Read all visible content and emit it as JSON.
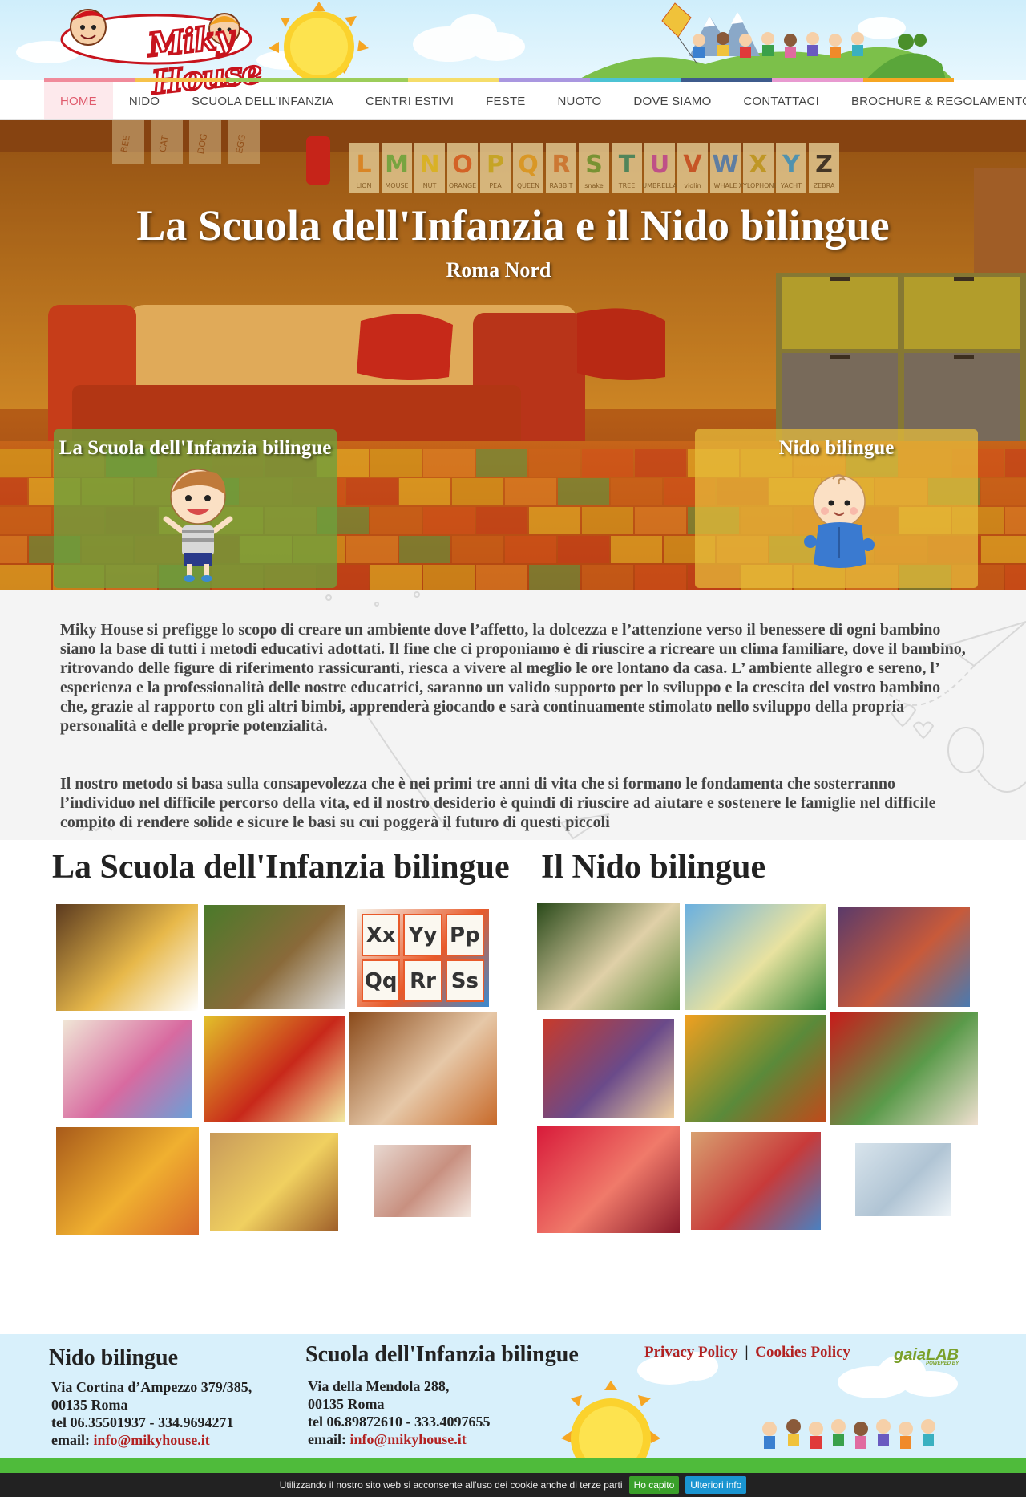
{
  "header": {
    "logo_text": "Miky House",
    "nav": [
      {
        "label": "HOME",
        "active": true
      },
      {
        "label": "NIDO",
        "active": false
      },
      {
        "label": "SCUOLA DELL'INFANZIA",
        "active": false
      },
      {
        "label": "CENTRI ESTIVI",
        "active": false
      },
      {
        "label": "FESTE",
        "active": false
      },
      {
        "label": "NUOTO",
        "active": false
      },
      {
        "label": "DOVE SIAMO",
        "active": false
      },
      {
        "label": "CONTATTACI",
        "active": false
      },
      {
        "label": "BROCHURE & REGOLAMENTO",
        "active": false
      }
    ],
    "strip_colors": [
      "#f08a9a",
      "#f6c24a",
      "#9ccd5a",
      "#9ccd5a",
      "#f5dd6a",
      "#a997e0",
      "#4cc3d4",
      "#3d5b8c",
      "#e89ad0",
      "#f6a623"
    ]
  },
  "hero": {
    "title": "La Scuola dell'Infanzia e il Nido bilingue",
    "subtitle": "Roma Nord",
    "card_infanzia": "La Scuola dell'Infanzia bilingue",
    "card_nido": "Nido bilingue",
    "alphabet_letters": [
      "L",
      "M",
      "N",
      "O",
      "P",
      "Q",
      "R",
      "S",
      "T",
      "U",
      "V",
      "W",
      "X",
      "Y",
      "Z"
    ],
    "alphabet_words": [
      "LION",
      "MOUSE",
      "NUT",
      "ORANGE",
      "PEA",
      "QUEEN",
      "RABBIT",
      "snake",
      "TREE",
      "UMBRELLA",
      "violin",
      "WHALE",
      "XYLOPHONE",
      "YACHT",
      "ZEBRA"
    ],
    "wall_words": [
      "BEE",
      "CAT",
      "DOG",
      "EGG"
    ]
  },
  "intro": {
    "p1": "Miky House si prefigge lo scopo di creare un ambiente dove l’affetto, la dolcezza e l’attenzione verso il benessere di ogni bambino siano la base di tutti i metodi educativi adottati. Il fine che ci proponiamo è di riuscire a ricreare un clima familiare, dove il bambino, ritrovando delle figure di riferimento rassicuranti, riesca a vivere al meglio le ore lontano da casa. L’ ambiente allegro e sereno, l’ esperienza e la professionalità delle nostre educatrici, saranno un valido supporto per lo sviluppo e la crescita del vostro bambino che, grazie al rapporto con gli altri bimbi, apprenderà giocando e sarà continuamente stimolato nello sviluppo della propria personalità e delle proprie potenzialità.",
    "p2": "Il nostro metodo si basa sulla consapevolezza che è nei primi tre anni di vita che si formano le fondamenta che sosterranno l’individuo nel difficile percorso della vita, ed il nostro desiderio è quindi di riuscire ad aiutare e sostenere le famiglie nel difficile compito di rendere solide e sicure le basi su cui poggerà il futuro di questi piccoli"
  },
  "galleries": {
    "infanzia_title": "La Scuola dell'Infanzia bilingue",
    "nido_title": "Il Nido bilingue",
    "infanzia_photos": [
      {
        "colors": [
          "#5b3a1f",
          "#e7b84a",
          "#ffffff"
        ],
        "label": "wooden animals toy"
      },
      {
        "colors": [
          "#4a7a2a",
          "#8a6a3a",
          "#e0e0e0"
        ],
        "label": "garden playground"
      },
      {
        "colors": [
          "#f7f3ea",
          "#e85a2a",
          "#3a8ad0"
        ],
        "label": "alphabet cards",
        "letters": [
          "Xx",
          "Yy",
          "Pp",
          "Qq",
          "Rr",
          "Ss"
        ]
      },
      {
        "colors": [
          "#f0e6d6",
          "#d86aa0",
          "#6aa0d8"
        ],
        "label": "play corner"
      },
      {
        "colors": [
          "#e2c02a",
          "#c8281a",
          "#f2e8a0"
        ],
        "label": "puppet theatre"
      },
      {
        "colors": [
          "#8a4a1a",
          "#e6c8a8",
          "#c86a2a"
        ],
        "label": "classroom window"
      },
      {
        "colors": [
          "#a85a1a",
          "#f0b030",
          "#d86a2a"
        ],
        "label": "reading corner"
      },
      {
        "colors": [
          "#c89a5a",
          "#f0d060",
          "#a0602a"
        ],
        "label": "classroom"
      },
      {
        "colors": [
          "#e8d8d0",
          "#c89080",
          "#f4e8e0"
        ],
        "label": "classroom faded"
      }
    ],
    "nido_photos": [
      {
        "colors": [
          "#2a4a1a",
          "#e0d0a8",
          "#5a8a3a"
        ],
        "label": "garden gazebo"
      },
      {
        "colors": [
          "#6ab0e0",
          "#e8e2a0",
          "#3a8a3a"
        ],
        "label": "blue chairs"
      },
      {
        "colors": [
          "#5a3a6a",
          "#c85a3a",
          "#4a7ab0"
        ],
        "label": "play room"
      },
      {
        "colors": [
          "#c83a2a",
          "#6a4a8a",
          "#f0d0a0"
        ],
        "label": "colorful room"
      },
      {
        "colors": [
          "#f0a020",
          "#5a8a3a",
          "#c04a1a"
        ],
        "label": "kitchen corner"
      },
      {
        "colors": [
          "#c81a1a",
          "#5a9a4a",
          "#f0e0d0"
        ],
        "label": "red curtains"
      },
      {
        "colors": [
          "#d81a3a",
          "#f07a6a",
          "#8a1a2a"
        ],
        "label": "red sofa"
      },
      {
        "colors": [
          "#d8a070",
          "#c83a3a",
          "#4a80c0"
        ],
        "label": "tables room"
      },
      {
        "colors": [
          "#d8e4ec",
          "#b0c4d4",
          "#eef4f8"
        ],
        "label": "faded room"
      }
    ]
  },
  "footer": {
    "col1_title": "Nido bilingue",
    "col1_address": "Via Cortina d’Ampezzo 379/385,",
    "col1_city": "00135 Roma",
    "col1_tel": "tel 06.35501937 - 334.9694271",
    "col1_email_label": "email:",
    "col1_email": "info@mikyhouse.it",
    "col2_title": "Scuola dell'Infanzia bilingue",
    "col2_address": "Via della Mendola 288,",
    "col2_city": "00135 Roma",
    "col2_tel": "tel 06.89872610 - 333.4097655",
    "col2_email_label": "email:",
    "col2_email": "info@mikyhouse.it",
    "privacy": "Privacy Policy",
    "separator": "|",
    "cookies": "Cookies Policy",
    "powered_brand": "gaiaLAB",
    "powered_by": "POWERED BY"
  },
  "cookie_bar": {
    "text": "Utilizzando il nostro sito web si acconsente all'uso dei cookie anche di terze parti",
    "ok": "Ho capito",
    "more": "Ulteriori info"
  }
}
